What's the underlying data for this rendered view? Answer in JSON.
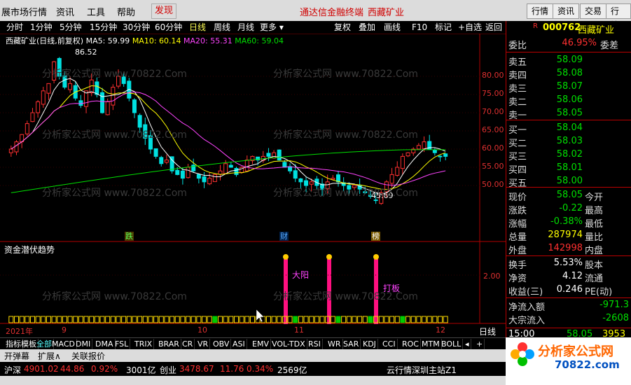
{
  "menu": {
    "items": [
      "展市场行情",
      "资讯",
      "工具",
      "帮助",
      "发现"
    ],
    "center_title": "通达信金融终端",
    "center_stock": "西藏矿业",
    "right_buttons": [
      "行情",
      "资讯",
      "交易",
      "行情"
    ]
  },
  "toolbar": {
    "periods": [
      "分时",
      "1分钟",
      "5分钟",
      "15分钟",
      "30分钟",
      "60分钟",
      "日线",
      "周线",
      "月线",
      "更多"
    ],
    "active_period": "日线",
    "more_arrow": "▾",
    "right_buttons": [
      "复权",
      "叠加",
      "画线",
      "F10",
      "标记",
      "+自选",
      "返回"
    ]
  },
  "chart": {
    "title_line": "西藏矿业(日线,前复权)",
    "ma5": "MA5: 59.99",
    "ma10": "MA10: 60.14",
    "ma20": "MA20: 55.31",
    "ma60": "MA60: 59.04",
    "high_label": "86.52",
    "low_label": "45.69",
    "price_ticks": [
      "80.00",
      "75.00",
      "70.00",
      "65.00",
      "60.00",
      "55.00",
      "50.00"
    ],
    "badges": [
      {
        "text": "跌"
      },
      {
        "text": "财"
      },
      {
        "text": "榜"
      }
    ],
    "watermark": "分析家公式网 www.70822.Com",
    "sub_title": "资金潜伏趋势",
    "sub_ticks": [
      "2.00"
    ],
    "signal_labels": [
      "大阳",
      "打板"
    ],
    "date_labels": [
      "2021年",
      "9",
      "10",
      "11",
      "12"
    ],
    "period_tag": "日线"
  },
  "stock": {
    "code": "000762",
    "name": "西藏矿业",
    "R": "R",
    "weibi_label": "委比",
    "weibi": "46.95%",
    "weicha_label": "委差",
    "asks": [
      {
        "label": "卖五",
        "price": "58.09"
      },
      {
        "label": "卖四",
        "price": "58.08"
      },
      {
        "label": "卖三",
        "price": "58.07"
      },
      {
        "label": "卖二",
        "price": "58.06"
      },
      {
        "label": "卖一",
        "price": "58.05"
      }
    ],
    "bids": [
      {
        "label": "买一",
        "price": "58.04"
      },
      {
        "label": "买二",
        "price": "58.03"
      },
      {
        "label": "买三",
        "price": "58.02"
      },
      {
        "label": "买四",
        "price": "58.01"
      },
      {
        "label": "买五",
        "price": "58.00"
      }
    ],
    "quote": [
      {
        "l": "现价",
        "v": "58.05",
        "l2": "今开",
        "c": "green"
      },
      {
        "l": "涨跌",
        "v": "-0.22",
        "l2": "最高",
        "c": "green"
      },
      {
        "l": "涨幅",
        "v": "-0.38%",
        "l2": "最低",
        "c": "green"
      },
      {
        "l": "总量",
        "v": "287974",
        "l2": "量比",
        "c": "yellow"
      },
      {
        "l": "外盘",
        "v": "142998",
        "l2": "内盘",
        "c": "red"
      }
    ],
    "quote2": [
      {
        "l": "换手",
        "v": "5.53%",
        "l2": "股本",
        "c": "white"
      },
      {
        "l": "净资",
        "v": "4.12",
        "l2": "流通",
        "c": "white"
      },
      {
        "l": "收益(三)",
        "v": "0.246",
        "l2": "PE(动)",
        "c": "white"
      }
    ],
    "flow": [
      {
        "l": "净流入额",
        "v": "-971.3"
      },
      {
        "l": "大宗流入",
        "v": "-2608"
      }
    ],
    "time": "15:00",
    "last_price": "58.05",
    "last_vol": "3953"
  },
  "tabs": [
    "指标",
    "模板",
    "全部",
    "MACD",
    "DMI",
    "DMA",
    "FSL",
    "TRIX",
    "BRAR",
    "CR",
    "VR",
    "OBV",
    "ASI",
    "EMV",
    "VOL-TDX",
    "RSI",
    "WR",
    "SAR",
    "KDJ",
    "CCI",
    "ROC",
    "MTM",
    "BOLL",
    "◂",
    "+"
  ],
  "tabs_selected": "全部",
  "bottom_tabs": [
    "开弹幕",
    "扩展∧",
    "关联报价"
  ],
  "status": [
    {
      "label": "沪深",
      "value": "4901.02",
      "change": "44.86",
      "pct": "0.92%",
      "amount": "3001亿"
    },
    {
      "label": "创业",
      "value": "3478.67",
      "change": "11.76",
      "pct": "0.34%",
      "amount": "2569亿"
    }
  ],
  "status_right": "云行情深圳主站Z1",
  "logo": {
    "text": "分析家公式网",
    "url": "70822.com"
  },
  "colors": {
    "up": "#ff3030",
    "down": "#00e0e0",
    "ma5": "#ffffff",
    "ma10": "#ffff00",
    "ma20": "#ff44ff",
    "ma60": "#00e000"
  }
}
